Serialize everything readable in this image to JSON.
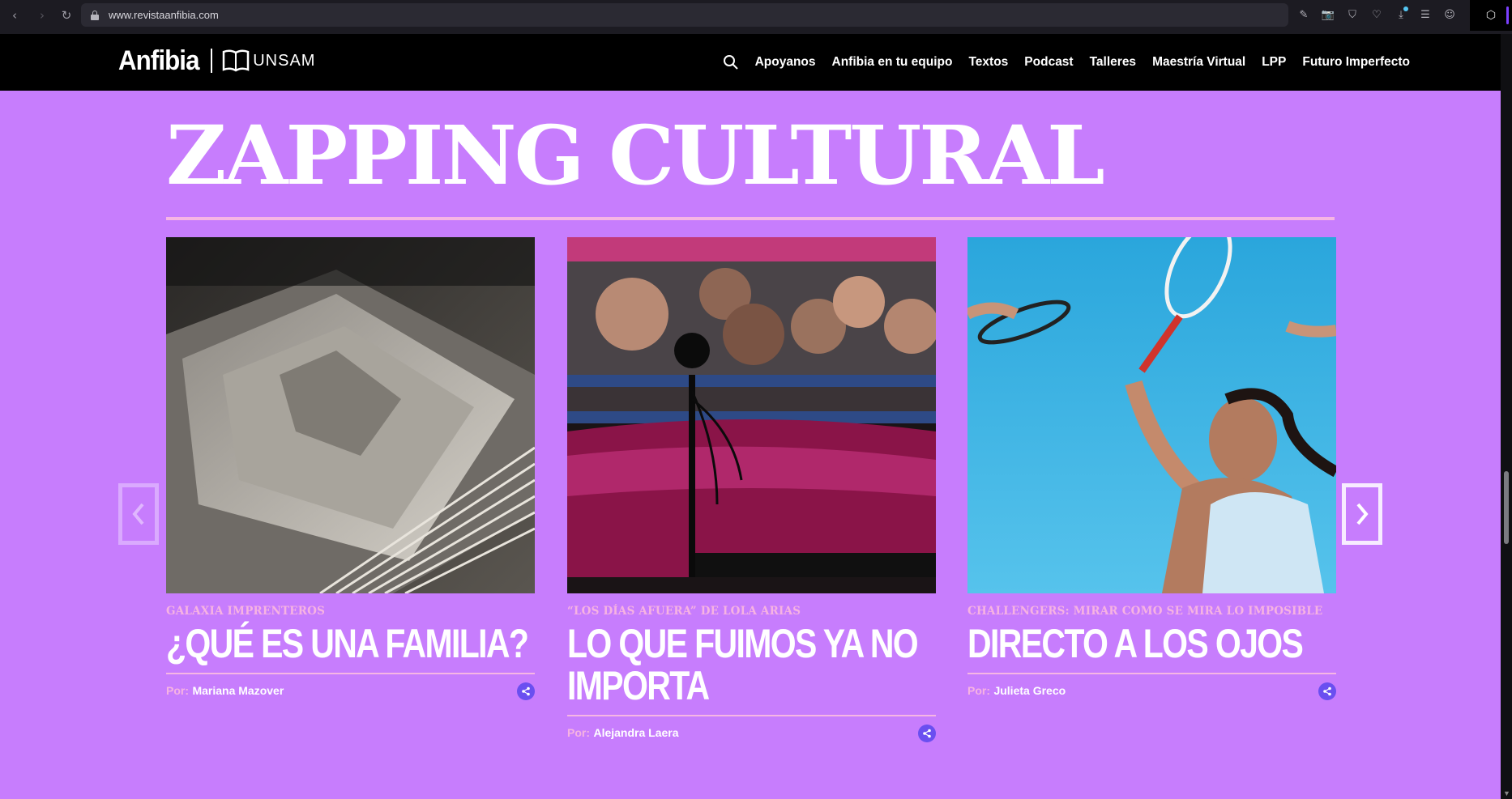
{
  "browser": {
    "url": "www.revistaanfibia.com",
    "back_icon": "‹",
    "forward_icon": "›",
    "reload_icon": "↻",
    "toolbar_icons": [
      "✎",
      "📷",
      "⛉",
      "♡",
      "⤓",
      "☰",
      "☺"
    ],
    "extension_icon": "⬡"
  },
  "site": {
    "logo_name": "Anfibia",
    "logo_partner": "UNSAM",
    "nav": [
      "Apoyanos",
      "Anfibia en tu equipo",
      "Textos",
      "Podcast",
      "Talleres",
      "Maestría Virtual",
      "LPP",
      "Futuro Imperfecto"
    ]
  },
  "section": {
    "title": "ZAPPING CULTURAL",
    "prev_arrow": "‹",
    "next_arrow": "›"
  },
  "cards": [
    {
      "kicker": "Galaxia imprenteros",
      "title": "¿Qué es una familia?",
      "by_label": "Por:",
      "author": "Mariana Mazover",
      "image": "printed-pages-photo"
    },
    {
      "kicker": "“Los días afuera” de Lola Arias",
      "title": "Lo que fuimos ya no importa",
      "by_label": "Por:",
      "author": "Alejandra Laera",
      "image": "women-in-car-photo"
    },
    {
      "kicker": "Challengers: mirar como se mira lo imposible",
      "title": "Directo a los ojos",
      "by_label": "Por:",
      "author": "Julieta Greco",
      "image": "tennis-player-photo"
    }
  ],
  "colors": {
    "page_bg": "#c77dfd",
    "accent_pink": "#f6b6e4",
    "share_blue": "#6a4ff0",
    "header_bg": "#000000"
  }
}
